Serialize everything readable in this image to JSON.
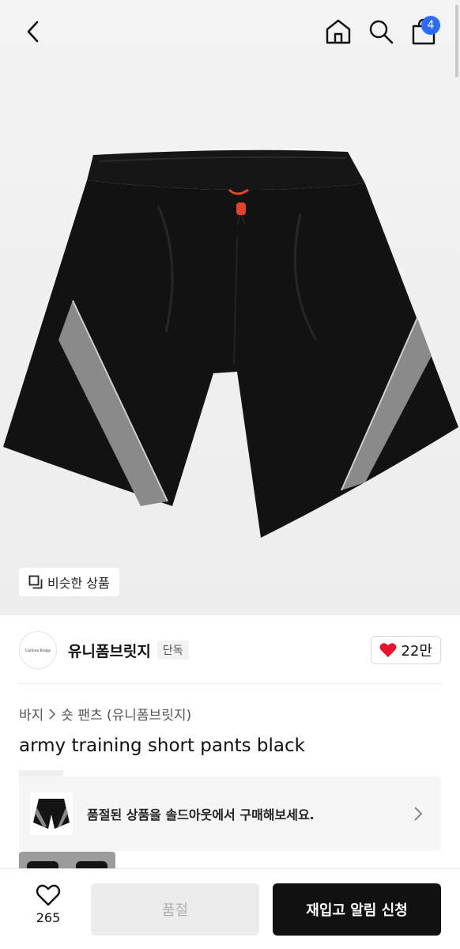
{
  "header": {
    "cart_count": "4"
  },
  "hero": {
    "similar_label": "비슷한 상품"
  },
  "brand": {
    "name": "유니폼브릿지",
    "tag": "단독",
    "logo_text": "Uniform Bridge",
    "likes": "22만"
  },
  "breadcrumb": {
    "category": "바지",
    "subcategory": "숏 팬츠 (유니폼브릿지)"
  },
  "product": {
    "title": "army training short pants black"
  },
  "soldout_banner": {
    "text": "품절된 상품을 솔드아웃에서 구매해보세요."
  },
  "bottom_bar": {
    "wish_count": "265",
    "soldout_label": "품절",
    "restock_label": "재입고 알림 신청"
  },
  "colors": {
    "badge": "#2b6bff",
    "heart": "#e8132b",
    "primary_button": "#111111"
  }
}
